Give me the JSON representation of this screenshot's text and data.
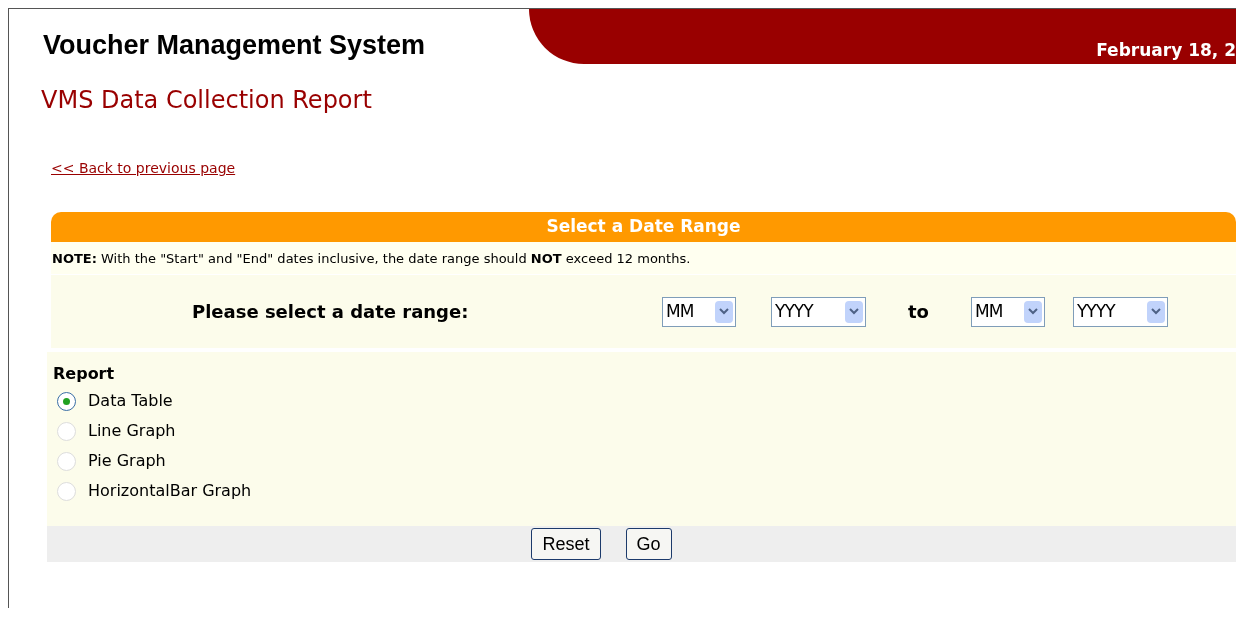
{
  "header": {
    "title": "Voucher Management System",
    "date": "February 18, 2"
  },
  "page_title": "VMS Data Collection Report",
  "back_link": "<< Back to previous page",
  "panel": {
    "title": "Select a Date Range",
    "note": "**NOTE:** With the \"Start\" and \"End\" dates inclusive, the date range should **NOT** exceed 12 months.",
    "range_label": "Please select a date range:",
    "start_month": "MM",
    "start_year": "YYYY",
    "separator": "to",
    "end_month": "MM",
    "end_year": "YYYY"
  },
  "report": {
    "label": "Report",
    "options": [
      {
        "label": "Data Table",
        "selected": true
      },
      {
        "label": "Line Graph",
        "selected": false
      },
      {
        "label": "Pie Graph",
        "selected": false
      },
      {
        "label": "HorizontalBar Graph",
        "selected": false
      }
    ]
  },
  "buttons": [
    "Reset",
    "Go"
  ]
}
